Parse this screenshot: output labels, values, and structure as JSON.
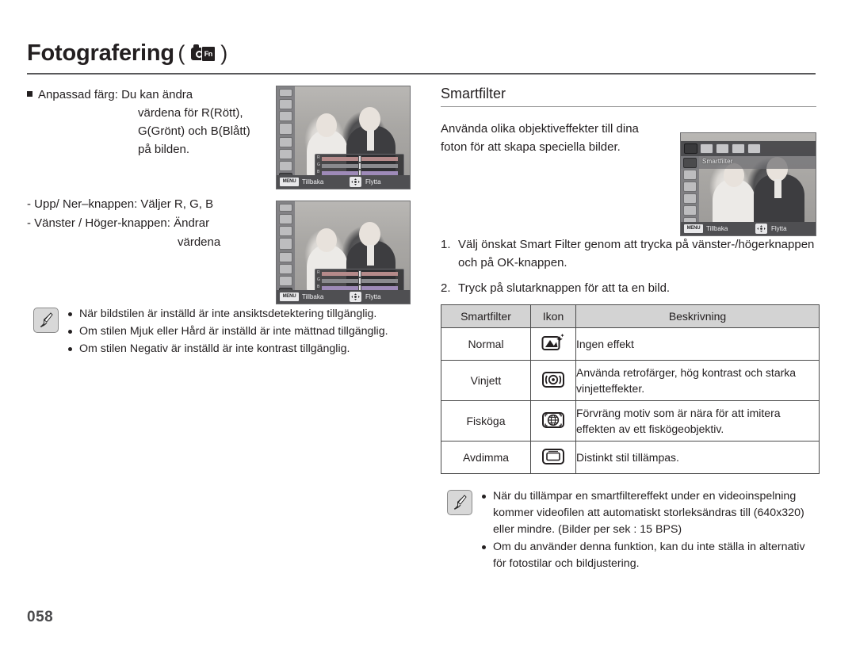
{
  "header": {
    "title": "Fotografering",
    "paren_open": "(",
    "paren_close": ")",
    "icon": "camera-fn-icon",
    "fn_label": "Fn"
  },
  "page_number": "058",
  "left_column": {
    "custom_color": {
      "label": "Anpassad färg: Du kan ändra",
      "line2": "värdena för R(Rött),",
      "line3": "G(Grönt) och B(Blått)",
      "line4": "på bilden."
    },
    "key_hints": [
      "- Upp/ Ner–knappen: Väljer R, G, B",
      "- Vänster / Höger-knappen: Ändrar",
      "värdena"
    ],
    "note": {
      "icon": "note-pen-icon",
      "items": [
        "När bildstilen är inställd är inte ansiktsdetektering tillgänglig.",
        "Om stilen Mjuk eller Hård är inställd är inte mättnad tillgänglig.",
        "Om stilen Negativ är inställd är inte kontrast tillgänglig."
      ]
    }
  },
  "right_column": {
    "section_title": "Smartfilter",
    "intro_line1": "Använda olika objektiveffekter till dina",
    "intro_line2": "foton för att skapa speciella bilder.",
    "steps": [
      {
        "num": "1.",
        "line1": "Välj önskat Smart Filter genom att trycka på vänster-/högerknappen",
        "line2": "och på OK-knappen."
      },
      {
        "num": "2.",
        "line1": "Tryck på slutarknappen för att ta en bild.",
        "line2": ""
      }
    ],
    "table": {
      "headers": [
        "Smartfilter",
        "Ikon",
        "Beskrivning"
      ],
      "rows": [
        {
          "name": "Normal",
          "icon": "normal-filter-icon",
          "desc_line1": "Ingen effekt",
          "desc_line2": ""
        },
        {
          "name": "Vinjett",
          "icon": "vignette-filter-icon",
          "desc_line1": "Använda retrofärger, hög kontrast och starka",
          "desc_line2": "vinjetteffekter."
        },
        {
          "name": "Fisköga",
          "icon": "fisheye-filter-icon",
          "desc_line1": "Förvräng motiv som är nära för att imitera",
          "desc_line2": "effekten av ett fiskögeobjektiv."
        },
        {
          "name": "Avdimma",
          "icon": "defog-filter-icon",
          "desc_line1": "Distinkt stil tillämpas.",
          "desc_line2": ""
        }
      ]
    },
    "note": {
      "icon": "note-pen-icon",
      "items": [
        {
          "line1": "När du tillämpar en smartfiltereffekt under en videoinspelning",
          "line2": "kommer videofilen att automatiskt storleksändras till (640x320)",
          "line3": "eller mindre. (Bilder per sek : 15 BPS)"
        },
        {
          "line1": "Om du använder denna funktion, kan du inte ställa in alternativ",
          "line2": "för fotostilar och bildjustering.",
          "line3": ""
        }
      ]
    }
  },
  "lcd_screens": {
    "back_button_label": "MENU",
    "back_label": "Tillbaka",
    "move_label": "Flytta",
    "smartfilter_label": "Smartfilter",
    "slider_labels": [
      "R",
      "G",
      "B"
    ]
  },
  "colors": {
    "text": "#231f20",
    "rule": "#59595b",
    "table_header_bg": "#d3d3d3",
    "table_border": "#4a4a4a",
    "note_icon_bg": "#d8d8d8"
  }
}
